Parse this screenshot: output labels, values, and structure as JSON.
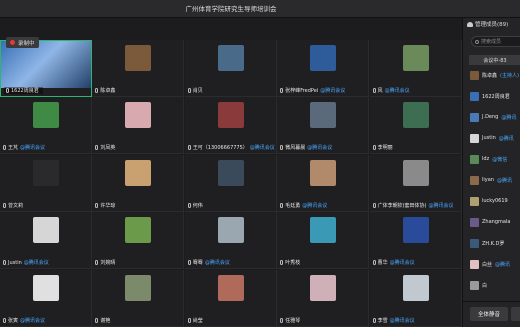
{
  "window": {
    "title": "广州体育学院研究生导师培训会"
  },
  "recording": {
    "label": "录制中"
  },
  "participants": [
    {
      "name": "1622周良君",
      "tag": "",
      "color": "#3a6fb5"
    },
    {
      "name": "陈卓鑫",
      "tag": "",
      "color": "#7a5a3a"
    },
    {
      "name": "肖贝",
      "tag": "",
      "color": "#4a6a8a"
    },
    {
      "name": "张梓峰FredPei",
      "tag": "@腾讯会议",
      "color": "#2e5c9a"
    },
    {
      "name": "风",
      "tag": "@腾讯会议",
      "color": "#6a8a5a"
    },
    {
      "name": "王芃",
      "tag": "@腾讯会议",
      "color": "#3f8a45"
    },
    {
      "name": "刘凤英",
      "tag": "",
      "color": "#d9a9b0"
    },
    {
      "name": "王可（13006667775）",
      "tag": "@腾讯会议",
      "color": "#8a3a3a"
    },
    {
      "name": "微风暮晨",
      "tag": "@腾讯会议",
      "color": "#5a6a7a"
    },
    {
      "name": "李明丽",
      "tag": "",
      "color": "#3d6e52"
    },
    {
      "name": "曾文莉",
      "tag": "",
      "color": "#2a2a2c"
    },
    {
      "name": "许华琼",
      "tag": "",
      "color": "#c9a070"
    },
    {
      "name": "何伟",
      "tag": "",
      "color": "#3a4a5a"
    },
    {
      "name": "毛廷勇",
      "tag": "@腾讯会议",
      "color": "#b08a6a"
    },
    {
      "name": "广体李朝钦(套田体协)",
      "tag": "@腾讯会议",
      "color": "#8a8a8a"
    },
    {
      "name": "Justin",
      "tag": "@腾讯会议",
      "color": "#d6d6d6"
    },
    {
      "name": "刘婉晴",
      "tag": "",
      "color": "#6a9a4a"
    },
    {
      "name": "骞骞",
      "tag": "@腾讯会议",
      "color": "#9aa6b0"
    },
    {
      "name": "叶秀枝",
      "tag": "",
      "color": "#3a9ab5"
    },
    {
      "name": "曹华",
      "tag": "@腾讯会议",
      "color": "#2a4a9a"
    },
    {
      "name": "张寅",
      "tag": "@腾讯会议",
      "color": "#e0e0e0"
    },
    {
      "name": "谢艳",
      "tag": "",
      "color": "#7a8a6a"
    },
    {
      "name": "尚莹",
      "tag": "",
      "color": "#b06a5a"
    },
    {
      "name": "任雅琴",
      "tag": "",
      "color": "#d0b0b8"
    },
    {
      "name": "李雪",
      "tag": "@腾讯会议",
      "color": "#c0c8d0"
    }
  ],
  "sidebar": {
    "title": "管理成员(89)",
    "search_placeholder": "搜索成员",
    "tab_label": "会议中-83",
    "members": [
      {
        "name": "陈卓鑫",
        "sub": "(主持人)",
        "color": "#7a5a3a"
      },
      {
        "name": "1622周良君",
        "sub": "",
        "color": "#3a6fb5"
      },
      {
        "name": "J.Deng",
        "sub": "@腾讯",
        "color": "#4a7ab5"
      },
      {
        "name": "Justin",
        "sub": "@腾讯",
        "color": "#d6d6d6"
      },
      {
        "name": "ldz",
        "sub": "@微信",
        "color": "#5a8a5a"
      },
      {
        "name": "liyan",
        "sub": "@腾讯",
        "color": "#8a6a4a"
      },
      {
        "name": "lucky0619",
        "sub": "",
        "color": "#b0a070"
      },
      {
        "name": "Zhangmala",
        "sub": "",
        "color": "#6a5a8a"
      },
      {
        "name": "ZH.K.D罗",
        "sub": "",
        "color": "#3a5a7a"
      },
      {
        "name": "白丝",
        "sub": "@腾讯",
        "color": "#e0c0c0"
      },
      {
        "name": "白",
        "sub": "",
        "color": "#9a9a9a"
      }
    ],
    "mute_all_label": "全体静音"
  }
}
